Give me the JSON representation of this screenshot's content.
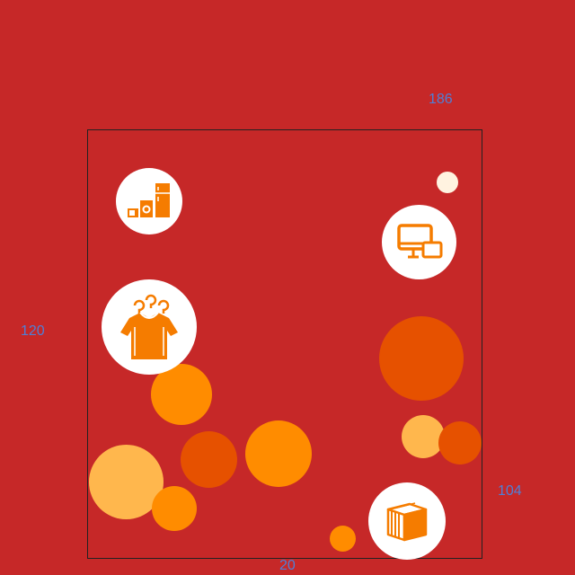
{
  "dimensions": {
    "top": "186",
    "left": "120",
    "right": "104",
    "bottom": "20"
  },
  "colors": {
    "background": "#c62828",
    "bubble_orange": "#ff8c00",
    "bubble_dark_orange": "#e65100",
    "bubble_light_orange": "#ffb74d",
    "bubble_cream": "#fff3e0",
    "icon_color": "#f57c00",
    "dimension_text": "#4f7fd6"
  },
  "icons": [
    "appliances-icon",
    "computer-devices-icon",
    "clothing-icon",
    "package-box-icon"
  ]
}
